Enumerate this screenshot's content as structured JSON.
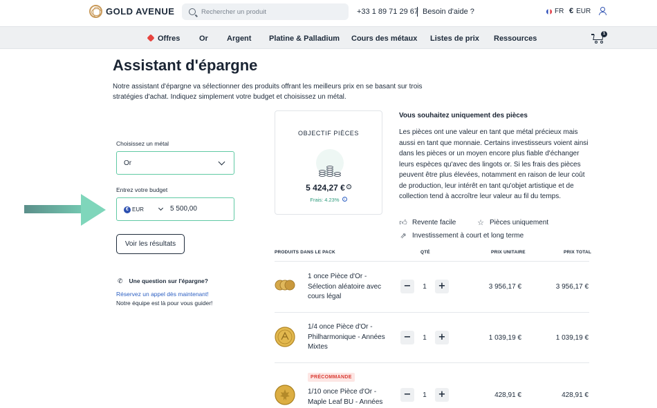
{
  "header": {
    "brand": "GOLD AVENUE",
    "search_placeholder": "Rechercher un produit",
    "phone": "+33 1 89 71 29 67",
    "help": "Besoin d'aide ?",
    "language": "FR",
    "currency": "EUR",
    "cart_count": "1"
  },
  "nav": {
    "items": [
      "Offres",
      "Or",
      "Argent",
      "Platine & Palladium",
      "Cours des métaux",
      "Listes de prix",
      "Ressources"
    ]
  },
  "page": {
    "title": "Assistant d'épargne",
    "intro": "Notre assistant d'épargne va sélectionner des produits offrant les meilleurs prix en se basant sur trois stratégies d'achat. Indiquez simplement votre budget et choisissez un métal."
  },
  "form": {
    "metal_label": "Choisissez un métal",
    "metal_value": "Or",
    "budget_label": "Entrez votre budget",
    "budget_currency": "EUR",
    "budget_value": "5 500,00",
    "results_button": "Voir les résultats"
  },
  "help_box": {
    "question": "Une question sur l'épargne?",
    "link": "Réservez un appel dès maintenant!",
    "sub": "Notre équipe est là pour vous guider!"
  },
  "objective": {
    "title": "OBJECTIF PIÈCES",
    "amount": "5 424,27 €",
    "fees": "Frais: 4.23%"
  },
  "description": {
    "title": "Vous souhaitez uniquement des pièces",
    "text": "Les pièces ont une valeur en tant que métal précieux mais aussi en tant que monnaie. Certains investisseurs voient ainsi dans les pièces or un moyen encore plus fiable d'échanger leurs espèces qu'avec des lingots or. Si les frais des pièces peuvent être plus élevées, notamment en raison de leur coût de production, leur intérêt en tant qu'objet artistique et de collection tend à accroître leur valeur au fil du temps.",
    "features": [
      "Revente facile",
      "Pièces uniquement",
      "Investissement à court et long terme"
    ]
  },
  "table": {
    "headers": {
      "product": "PRODUITS DANS LE PACK",
      "qty": "QTÉ",
      "unit": "PRIX UNITAIRE",
      "total": "PRIX TOTAL"
    },
    "rows": [
      {
        "name": "1 once Pièce d'Or - Sélection aléatoire avec cours légal",
        "qty": "1",
        "unit": "3 956,17 €",
        "total": "3 956,17 €",
        "badge": ""
      },
      {
        "name": "1/4 once Pièce d'Or - Philharmonique - Années Mixtes",
        "qty": "1",
        "unit": "1 039,19 €",
        "total": "1 039,19 €",
        "badge": ""
      },
      {
        "name": "1/10 once Pièce d'Or - Maple Leaf BU - Années",
        "qty": "1",
        "unit": "428,91 €",
        "total": "428,91 €",
        "badge": "PRÉCOMMANDE"
      }
    ]
  },
  "colors": {
    "accent_green": "#5fc9a3",
    "link_blue": "#2c5fc2",
    "preorder_red": "#d93b33"
  }
}
